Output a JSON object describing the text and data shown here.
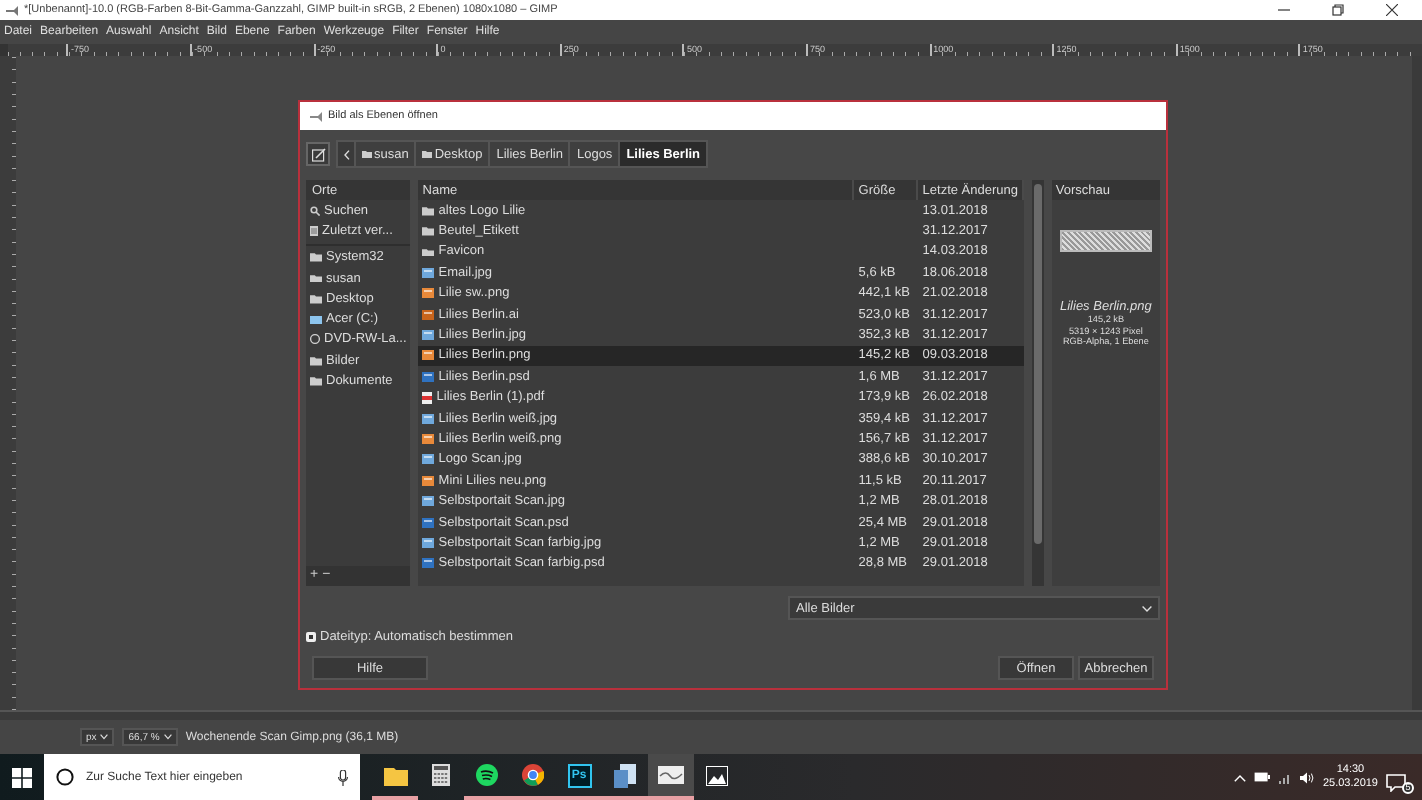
{
  "window": {
    "title": "*[Unbenannt]-10.0 (RGB-Farben 8-Bit-Gamma-Ganzzahl, GIMP built-in sRGB, 2 Ebenen) 1080x1080 – GIMP"
  },
  "menu": [
    "Datei",
    "Bearbeiten",
    "Auswahl",
    "Ansicht",
    "Bild",
    "Ebene",
    "Farben",
    "Werkzeuge",
    "Filter",
    "Fenster",
    "Hilfe"
  ],
  "ruler": [
    "-750",
    "-500",
    "-250",
    "0",
    "250",
    "500",
    "750",
    "1000",
    "1250",
    "1500",
    "1750"
  ],
  "dialog": {
    "title": "Bild als Ebenen öffnen",
    "breadcrumb": [
      {
        "label": "susan",
        "folder": true,
        "selected": false
      },
      {
        "label": "Desktop",
        "folder": true,
        "selected": false
      },
      {
        "label": "Lilies Berlin",
        "folder": false,
        "selected": false
      },
      {
        "label": "Logos",
        "folder": false,
        "selected": false
      },
      {
        "label": "Lilies Berlin",
        "folder": false,
        "selected": true
      }
    ],
    "places_heading": "Orte",
    "places": [
      {
        "label": "Suchen",
        "kind": "search",
        "selected": false
      },
      {
        "label": "Zuletzt ver...",
        "kind": "recent",
        "selected": false
      },
      {
        "label": "System32",
        "kind": "folder",
        "selected": false
      },
      {
        "label": "susan",
        "kind": "folder",
        "selected": false
      },
      {
        "label": "Desktop",
        "kind": "folder",
        "selected": false
      },
      {
        "label": "Acer (C:)",
        "kind": "drive",
        "selected": false
      },
      {
        "label": "DVD-RW-La...",
        "kind": "optical",
        "selected": false
      },
      {
        "label": "Bilder",
        "kind": "folder",
        "selected": false
      },
      {
        "label": "Dokumente",
        "kind": "folder",
        "selected": false
      }
    ],
    "places_buttons": [
      "+",
      "−"
    ],
    "columns": [
      "Name",
      "Größe",
      "Letzte Änderung"
    ],
    "files": [
      {
        "name": "altes Logo Lilie",
        "kind": "folder",
        "modified": "13.01.2018",
        "selected": false
      },
      {
        "name": "Beutel_Etikett",
        "kind": "folder",
        "modified": "31.12.2017",
        "selected": false
      },
      {
        "name": "Favicon",
        "kind": "folder",
        "modified": "14.03.2018",
        "selected": false
      },
      {
        "name": "Email.jpg",
        "kind": "jpg",
        "size": "5,6 kB",
        "modified": "18.06.2018",
        "selected": false
      },
      {
        "name": "Lilie sw..png",
        "kind": "png",
        "size": "442,1 kB",
        "modified": "21.02.2018",
        "selected": false
      },
      {
        "name": "Lilies Berlin.ai",
        "kind": "ai",
        "size": "523,0 kB",
        "modified": "31.12.2017",
        "selected": false
      },
      {
        "name": "Lilies Berlin.jpg",
        "kind": "jpg",
        "size": "352,3 kB",
        "modified": "31.12.2017",
        "selected": false
      },
      {
        "name": "Lilies Berlin.png",
        "kind": "png",
        "size": "145,2 kB",
        "modified": "09.03.2018",
        "selected": true
      },
      {
        "name": "Lilies Berlin.psd",
        "kind": "psd",
        "size": "1,6 MB",
        "modified": "31.12.2017",
        "selected": false
      },
      {
        "name": "Lilies Berlin (1).pdf",
        "kind": "pdf",
        "size": "173,9 kB",
        "modified": "26.02.2018",
        "selected": false
      },
      {
        "name": "Lilies Berlin weiß.jpg",
        "kind": "jpg",
        "size": "359,4 kB",
        "modified": "31.12.2017",
        "selected": false
      },
      {
        "name": "Lilies Berlin weiß.png",
        "kind": "png",
        "size": "156,7 kB",
        "modified": "31.12.2017",
        "selected": false
      },
      {
        "name": "Logo Scan.jpg",
        "kind": "jpg",
        "size": "388,6 kB",
        "modified": "30.10.2017",
        "selected": false
      },
      {
        "name": "Mini Lilies neu.png",
        "kind": "png",
        "size": "11,5 kB",
        "modified": "20.11.2017",
        "selected": false
      },
      {
        "name": "Selbstportait Scan.jpg",
        "kind": "jpg",
        "size": "1,2 MB",
        "modified": "28.01.2018",
        "selected": false
      },
      {
        "name": "Selbstportait Scan.psd",
        "kind": "psd",
        "size": "25,4 MB",
        "modified": "29.01.2018",
        "selected": false
      },
      {
        "name": "Selbstportait Scan farbig.jpg",
        "kind": "jpg",
        "size": "1,2 MB",
        "modified": "29.01.2018",
        "selected": false
      },
      {
        "name": "Selbstportait Scan farbig.psd",
        "kind": "psd",
        "size": "28,8 MB",
        "modified": "29.01.2018",
        "selected": false
      }
    ],
    "preview": {
      "heading": "Vorschau",
      "filename": "Lilies Berlin.png",
      "info": [
        "145,2 kB",
        "5319 × 1243 Pixel",
        "RGB-Alpha, 1 Ebene"
      ]
    },
    "filter": "Alle Bilder",
    "filetype": "Dateityp: Automatisch bestimmen",
    "help_button": "Hilfe",
    "buttons": [
      "Öffnen",
      "Abbrechen"
    ]
  },
  "status_bar": {
    "unit": "px",
    "zoom": "66,7 %",
    "file": "Wochenende Scan Gimp.png (36,1 MB)"
  },
  "taskbar": {
    "search_placeholder": "Zur Suche Text hier eingeben",
    "apps": [
      {
        "kind": "folder",
        "running": true,
        "active": false
      },
      {
        "kind": "calculator",
        "running": false,
        "active": false
      },
      {
        "kind": "music",
        "running": true,
        "active": false
      },
      {
        "kind": "browser",
        "running": true,
        "active": false
      },
      {
        "kind": "ps",
        "label": "Ps",
        "running": true,
        "active": false
      },
      {
        "kind": "document",
        "running": true,
        "active": false
      },
      {
        "kind": "gimp",
        "running": true,
        "active": true
      },
      {
        "kind": "photos",
        "running": false,
        "active": false
      }
    ],
    "time": "14:30",
    "date": "25.03.2019",
    "notifications": "5"
  }
}
